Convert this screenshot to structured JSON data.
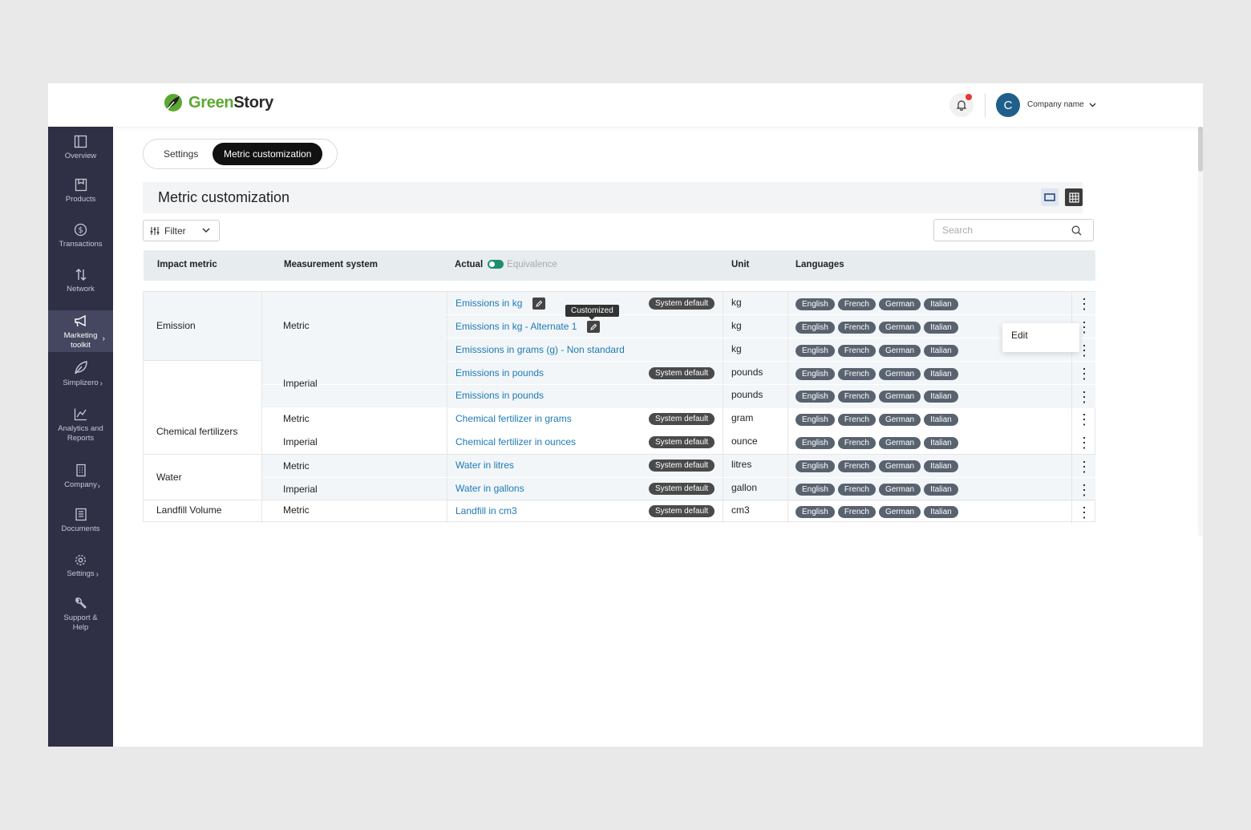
{
  "brand": {
    "name_part1": "Green",
    "name_part2": "Story",
    "color": "#5aa832"
  },
  "header": {
    "company_name": "Company name",
    "avatar_letter": "C",
    "notification_dot_color": "#e53935"
  },
  "sidebar": {
    "items": [
      {
        "label": "Overview",
        "icon": "overview-icon"
      },
      {
        "label": "Products",
        "icon": "products-icon"
      },
      {
        "label": "Transactions",
        "icon": "dollar-icon"
      },
      {
        "label": "Network",
        "icon": "network-icon"
      },
      {
        "label": "Marketing toolkit",
        "icon": "megaphone-icon",
        "active": true
      },
      {
        "label": "Simplizero",
        "icon": "leaf-icon"
      },
      {
        "label": "Analytics and Reports",
        "icon": "chart-icon"
      },
      {
        "label": "Company",
        "icon": "building-icon"
      },
      {
        "label": "Documents",
        "icon": "document-icon"
      },
      {
        "label": "Settings",
        "icon": "gear-icon"
      },
      {
        "label": "Support & Help",
        "icon": "wrench-icon"
      }
    ]
  },
  "tabs": {
    "settings": "Settings",
    "metric": "Metric customization"
  },
  "page_title": "Metric customization",
  "filter_label": "Filter",
  "search_placeholder": "Search",
  "table": {
    "headers": {
      "impact_metric": "Impact metric",
      "measurement_system": "Measurement system",
      "actual": "Actual",
      "equivalence": "Equivalence",
      "unit": "Unit",
      "languages": "Languages"
    },
    "groups": {
      "emission": "Emission",
      "chemical": "Chemical fertilizers",
      "water": "Water",
      "landfill": "Landfill Volume"
    },
    "systems": {
      "emission_metric": "Metric",
      "emission_imperial": "Imperial",
      "chem_metric": "Metric",
      "chem_imperial": "Imperial",
      "water_metric": "Metric",
      "water_imperial": "Imperial",
      "landfill_metric": "Metric"
    },
    "rows": [
      {
        "name": "Emissions in kg",
        "unit": "kg",
        "badge": "System default"
      },
      {
        "name": "Emissions in kg - Alternate 1",
        "unit": "kg",
        "badge": ""
      },
      {
        "name": "Emisssions in grams (g) - Non standard",
        "unit": "kg",
        "badge": ""
      },
      {
        "name": "Emissions in pounds",
        "unit": "pounds",
        "badge": "System default"
      },
      {
        "name": "Emissions in pounds",
        "unit": "pounds",
        "badge": ""
      },
      {
        "name": "Chemical fertilizer in grams",
        "unit": "gram",
        "badge": "System default"
      },
      {
        "name": "Chemical fertilizer in ounces",
        "unit": "ounce",
        "badge": "System default"
      },
      {
        "name": "Water in litres",
        "unit": "litres",
        "badge": "System default"
      },
      {
        "name": "Water in gallons",
        "unit": "gallon",
        "badge": "System default"
      },
      {
        "name": "Landfill in cm3",
        "unit": "cm3",
        "badge": "System default"
      }
    ],
    "languages": [
      "English",
      "French",
      "German",
      "Italian"
    ]
  },
  "tooltip": "Customized",
  "context_menu": {
    "edit": "Edit"
  }
}
